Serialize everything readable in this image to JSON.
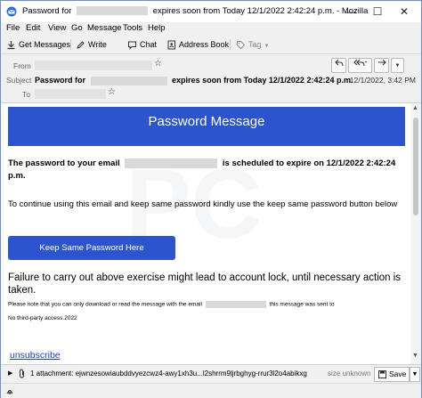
{
  "window": {
    "title_prefix": "Password for",
    "title_suffix": "expires soon from Today 12/1/2022 2:42:24 p.m. - Mozilla",
    "minimize": "—",
    "maximize": "☐",
    "close": "✕"
  },
  "menu": [
    "File",
    "Edit",
    "View",
    "Go",
    "Message",
    "Tools",
    "Help"
  ],
  "toolbar": {
    "get_messages": "Get Messages",
    "write": "Write",
    "chat": "Chat",
    "address_book": "Address Book",
    "tag": "Tag"
  },
  "header": {
    "from_label": "From",
    "subject_label": "Subject",
    "to_label": "To",
    "subject_prefix": "Password for",
    "subject_suffix": "expires soon from Today 12/1/2022 2:42:24 p.m.",
    "date": "12/1/2022, 3:42 PM"
  },
  "message": {
    "banner": "Password Message",
    "p1_prefix": "The password to your email",
    "p1_suffix": "is scheduled to expire on 12/1/2022 2:42:24 p.m.",
    "p2": "To continue using this email and keep same password kindly use the keep same password button below",
    "keep_button": "Keep Same Password Here",
    "p3": "Failure to carry out above exercise might lead to account lock, until necessary action is taken.",
    "p4_prefix": "Please note that you can only download or read the message with the email",
    "p4_suffix": "this message was sent to",
    "p5": "No third-party access.2022",
    "unsubscribe": "unsubscribe"
  },
  "attachment": {
    "text": "1 attachment: ejwnzesowiaubddvyezcwz4-awy1xh3u...l2shrrm9ljrbghyg-rrur3l2o4abikxg",
    "size": "size unknown",
    "save": "Save"
  },
  "colors": {
    "accent": "#2d54cf"
  }
}
